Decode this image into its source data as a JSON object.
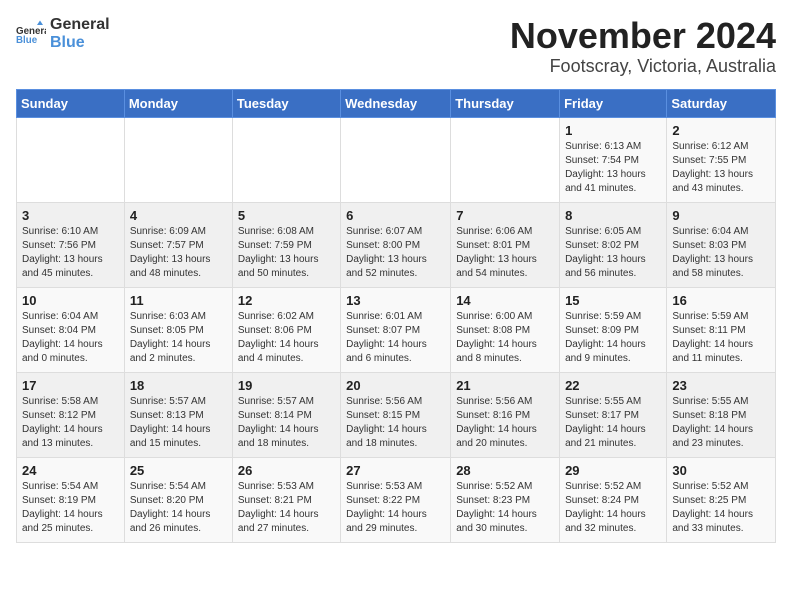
{
  "logo": {
    "text_general": "General",
    "text_blue": "Blue"
  },
  "title": "November 2024",
  "location": "Footscray, Victoria, Australia",
  "header_days": [
    "Sunday",
    "Monday",
    "Tuesday",
    "Wednesday",
    "Thursday",
    "Friday",
    "Saturday"
  ],
  "weeks": [
    [
      {
        "day": "",
        "detail": ""
      },
      {
        "day": "",
        "detail": ""
      },
      {
        "day": "",
        "detail": ""
      },
      {
        "day": "",
        "detail": ""
      },
      {
        "day": "",
        "detail": ""
      },
      {
        "day": "1",
        "detail": "Sunrise: 6:13 AM\nSunset: 7:54 PM\nDaylight: 13 hours\nand 41 minutes."
      },
      {
        "day": "2",
        "detail": "Sunrise: 6:12 AM\nSunset: 7:55 PM\nDaylight: 13 hours\nand 43 minutes."
      }
    ],
    [
      {
        "day": "3",
        "detail": "Sunrise: 6:10 AM\nSunset: 7:56 PM\nDaylight: 13 hours\nand 45 minutes."
      },
      {
        "day": "4",
        "detail": "Sunrise: 6:09 AM\nSunset: 7:57 PM\nDaylight: 13 hours\nand 48 minutes."
      },
      {
        "day": "5",
        "detail": "Sunrise: 6:08 AM\nSunset: 7:59 PM\nDaylight: 13 hours\nand 50 minutes."
      },
      {
        "day": "6",
        "detail": "Sunrise: 6:07 AM\nSunset: 8:00 PM\nDaylight: 13 hours\nand 52 minutes."
      },
      {
        "day": "7",
        "detail": "Sunrise: 6:06 AM\nSunset: 8:01 PM\nDaylight: 13 hours\nand 54 minutes."
      },
      {
        "day": "8",
        "detail": "Sunrise: 6:05 AM\nSunset: 8:02 PM\nDaylight: 13 hours\nand 56 minutes."
      },
      {
        "day": "9",
        "detail": "Sunrise: 6:04 AM\nSunset: 8:03 PM\nDaylight: 13 hours\nand 58 minutes."
      }
    ],
    [
      {
        "day": "10",
        "detail": "Sunrise: 6:04 AM\nSunset: 8:04 PM\nDaylight: 14 hours\nand 0 minutes."
      },
      {
        "day": "11",
        "detail": "Sunrise: 6:03 AM\nSunset: 8:05 PM\nDaylight: 14 hours\nand 2 minutes."
      },
      {
        "day": "12",
        "detail": "Sunrise: 6:02 AM\nSunset: 8:06 PM\nDaylight: 14 hours\nand 4 minutes."
      },
      {
        "day": "13",
        "detail": "Sunrise: 6:01 AM\nSunset: 8:07 PM\nDaylight: 14 hours\nand 6 minutes."
      },
      {
        "day": "14",
        "detail": "Sunrise: 6:00 AM\nSunset: 8:08 PM\nDaylight: 14 hours\nand 8 minutes."
      },
      {
        "day": "15",
        "detail": "Sunrise: 5:59 AM\nSunset: 8:09 PM\nDaylight: 14 hours\nand 9 minutes."
      },
      {
        "day": "16",
        "detail": "Sunrise: 5:59 AM\nSunset: 8:11 PM\nDaylight: 14 hours\nand 11 minutes."
      }
    ],
    [
      {
        "day": "17",
        "detail": "Sunrise: 5:58 AM\nSunset: 8:12 PM\nDaylight: 14 hours\nand 13 minutes."
      },
      {
        "day": "18",
        "detail": "Sunrise: 5:57 AM\nSunset: 8:13 PM\nDaylight: 14 hours\nand 15 minutes."
      },
      {
        "day": "19",
        "detail": "Sunrise: 5:57 AM\nSunset: 8:14 PM\nDaylight: 14 hours\nand 18 minutes."
      },
      {
        "day": "20",
        "detail": "Sunrise: 5:56 AM\nSunset: 8:15 PM\nDaylight: 14 hours\nand 18 minutes."
      },
      {
        "day": "21",
        "detail": "Sunrise: 5:56 AM\nSunset: 8:16 PM\nDaylight: 14 hours\nand 20 minutes."
      },
      {
        "day": "22",
        "detail": "Sunrise: 5:55 AM\nSunset: 8:17 PM\nDaylight: 14 hours\nand 21 minutes."
      },
      {
        "day": "23",
        "detail": "Sunrise: 5:55 AM\nSunset: 8:18 PM\nDaylight: 14 hours\nand 23 minutes."
      }
    ],
    [
      {
        "day": "24",
        "detail": "Sunrise: 5:54 AM\nSunset: 8:19 PM\nDaylight: 14 hours\nand 25 minutes."
      },
      {
        "day": "25",
        "detail": "Sunrise: 5:54 AM\nSunset: 8:20 PM\nDaylight: 14 hours\nand 26 minutes."
      },
      {
        "day": "26",
        "detail": "Sunrise: 5:53 AM\nSunset: 8:21 PM\nDaylight: 14 hours\nand 27 minutes."
      },
      {
        "day": "27",
        "detail": "Sunrise: 5:53 AM\nSunset: 8:22 PM\nDaylight: 14 hours\nand 29 minutes."
      },
      {
        "day": "28",
        "detail": "Sunrise: 5:52 AM\nSunset: 8:23 PM\nDaylight: 14 hours\nand 30 minutes."
      },
      {
        "day": "29",
        "detail": "Sunrise: 5:52 AM\nSunset: 8:24 PM\nDaylight: 14 hours\nand 32 minutes."
      },
      {
        "day": "30",
        "detail": "Sunrise: 5:52 AM\nSunset: 8:25 PM\nDaylight: 14 hours\nand 33 minutes."
      }
    ]
  ]
}
